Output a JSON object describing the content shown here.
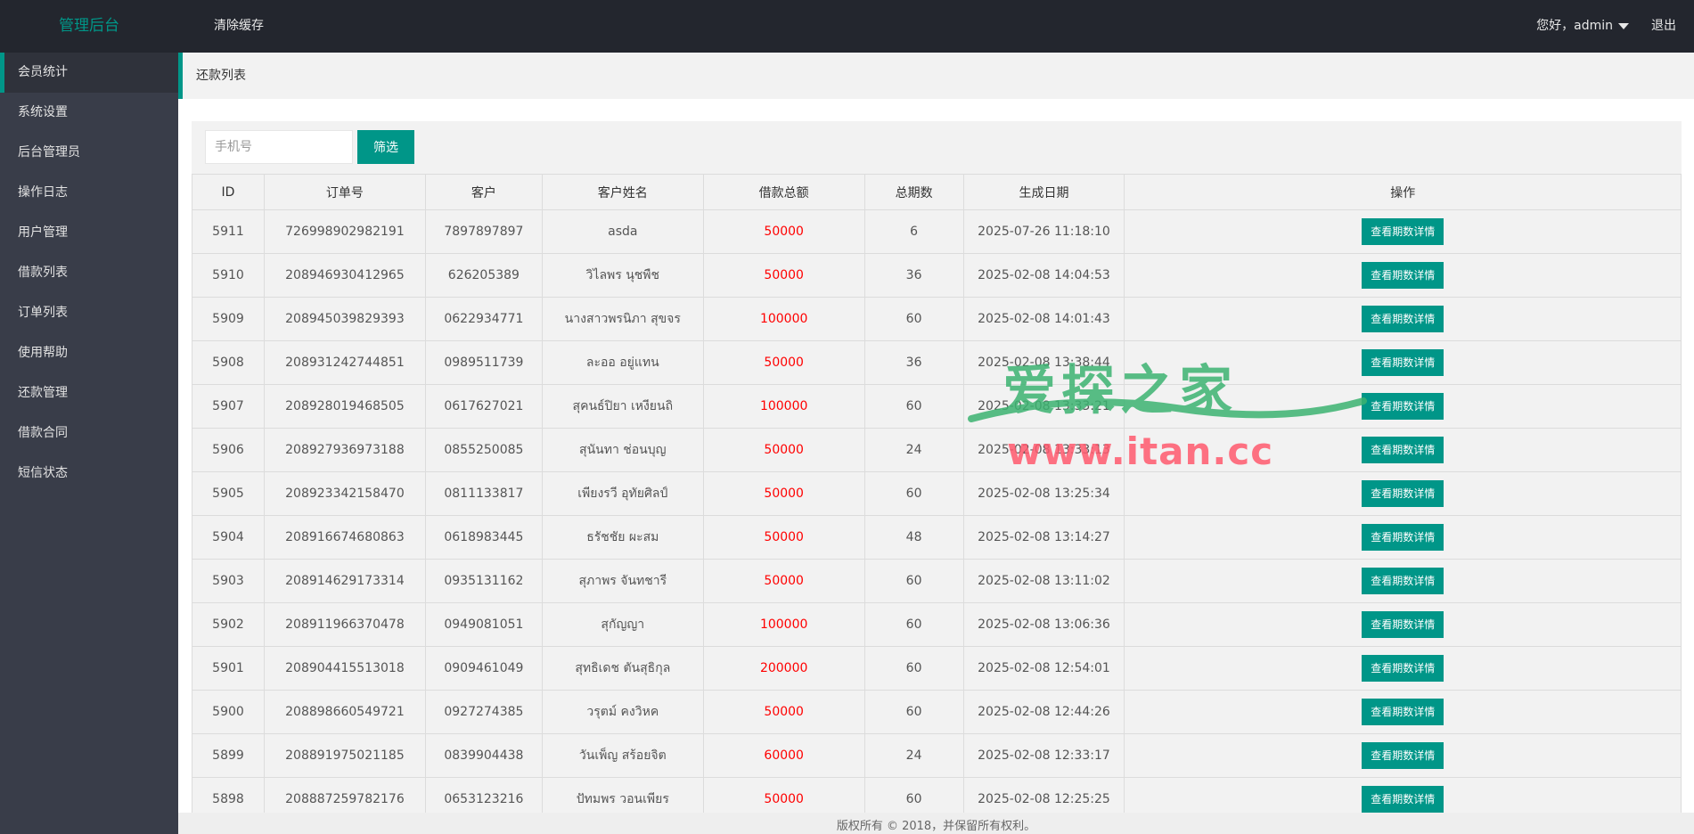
{
  "header": {
    "logo": "管理后台",
    "clear_cache": "清除缓存",
    "greeting": "您好，admin",
    "logout": "退出"
  },
  "sidebar": {
    "items": [
      {
        "label": "会员统计"
      },
      {
        "label": "系统设置"
      },
      {
        "label": "后台管理员"
      },
      {
        "label": "操作日志"
      },
      {
        "label": "用户管理"
      },
      {
        "label": "借款列表"
      },
      {
        "label": "订单列表"
      },
      {
        "label": "使用帮助"
      },
      {
        "label": "还款管理"
      },
      {
        "label": "借款合同"
      },
      {
        "label": "短信状态"
      }
    ]
  },
  "page": {
    "breadcrumb": "还款列表"
  },
  "filter": {
    "placeholder": "手机号",
    "button": "筛选"
  },
  "table": {
    "headers": [
      "ID",
      "订单号",
      "客户",
      "客户姓名",
      "借款总额",
      "总期数",
      "生成日期",
      "操作"
    ],
    "action_label": "查看期数详情",
    "rows": [
      {
        "id": "5911",
        "order": "726998902982191",
        "customer": "7897897897",
        "name": "asda",
        "amount": "50000",
        "periods": "6",
        "date": "2025-07-26 11:18:10"
      },
      {
        "id": "5910",
        "order": "208946930412965",
        "customer": "626205389",
        "name": "วิไลพร นุชพืช",
        "amount": "50000",
        "periods": "36",
        "date": "2025-02-08 14:04:53"
      },
      {
        "id": "5909",
        "order": "208945039829393",
        "customer": "0622934771",
        "name": "นางสาวพรนิภา สุขจร",
        "amount": "100000",
        "periods": "60",
        "date": "2025-02-08 14:01:43"
      },
      {
        "id": "5908",
        "order": "208931242744851",
        "customer": "0989511739",
        "name": "ละออ อยู่แทน",
        "amount": "50000",
        "periods": "36",
        "date": "2025-02-08 13:38:44"
      },
      {
        "id": "5907",
        "order": "208928019468505",
        "customer": "0617627021",
        "name": "สุคนธ์ปิยา เหงียนถิ",
        "amount": "100000",
        "periods": "60",
        "date": "2025-02-08 13:33:21"
      },
      {
        "id": "5906",
        "order": "208927936973188",
        "customer": "0855250085",
        "name": "สุนันทา ช่อนบุญ",
        "amount": "50000",
        "periods": "24",
        "date": "2025-02-08 13:33:13"
      },
      {
        "id": "5905",
        "order": "208923342158470",
        "customer": "0811133817",
        "name": "เพียงรวี อุทัยศิลป์",
        "amount": "50000",
        "periods": "60",
        "date": "2025-02-08 13:25:34"
      },
      {
        "id": "5904",
        "order": "208916674680863",
        "customer": "0618983445",
        "name": "ธรัชชัย ผะสม",
        "amount": "50000",
        "periods": "48",
        "date": "2025-02-08 13:14:27"
      },
      {
        "id": "5903",
        "order": "208914629173314",
        "customer": "0935131162",
        "name": "สุภาพร จันทชารี",
        "amount": "50000",
        "periods": "60",
        "date": "2025-02-08 13:11:02"
      },
      {
        "id": "5902",
        "order": "208911966370478",
        "customer": "0949081051",
        "name": "สุกัญญา",
        "amount": "100000",
        "periods": "60",
        "date": "2025-02-08 13:06:36"
      },
      {
        "id": "5901",
        "order": "208904415513018",
        "customer": "0909461049",
        "name": "สุทธิเดช ตันสุธิกุล",
        "amount": "200000",
        "periods": "60",
        "date": "2025-02-08 12:54:01"
      },
      {
        "id": "5900",
        "order": "208898660549721",
        "customer": "0927274385",
        "name": "วรุตม์ คงวิหค",
        "amount": "50000",
        "periods": "60",
        "date": "2025-02-08 12:44:26"
      },
      {
        "id": "5899",
        "order": "208891975021185",
        "customer": "0839904438",
        "name": "วันเพ็ญ สร้อยจิต",
        "amount": "60000",
        "periods": "24",
        "date": "2025-02-08 12:33:17"
      },
      {
        "id": "5898",
        "order": "208887259782176",
        "customer": "0653123216",
        "name": "ปัทมพร วอนเพียร",
        "amount": "50000",
        "periods": "60",
        "date": "2025-02-08 12:25:25"
      }
    ]
  },
  "footer": {
    "text": "版权所有 © 2018，并保留所有权利。"
  },
  "watermark": {
    "top": "爱探之家",
    "bottom": "www.itan.cc"
  },
  "colors": {
    "accent": "#009688",
    "header_bg": "#23262e",
    "sidebar_bg": "#393d49",
    "amount": "#ff0000"
  }
}
